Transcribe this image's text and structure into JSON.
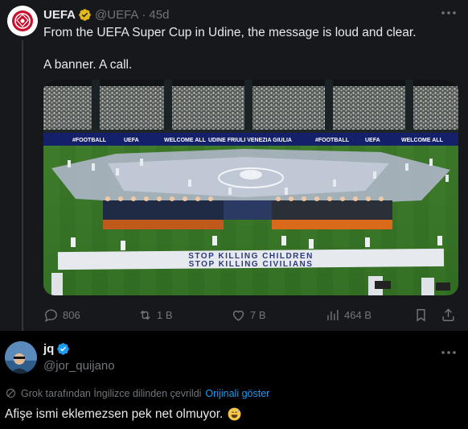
{
  "post": {
    "author_name": "UEFA",
    "author_handle": "@UEFA",
    "separator": "·",
    "time": "45d",
    "text": "From the UEFA Super Cup in Udine, the message is loud and clear.\n\nA banner. A call.",
    "media": {
      "board_texts": [
        "#FOOTBALL",
        "UEFA",
        "WELCOME ALL",
        "UDINE FRIULI VENEZIA GIULIA",
        "#FOOTBALL",
        "UEFA",
        "WELCOME ALL"
      ],
      "banner_line1": "STOP KILLING CHILDREN",
      "banner_line2": "STOP KILLING CIVILIANS"
    },
    "stats": {
      "replies": "806",
      "reposts": "1 B",
      "likes": "7 B",
      "views": "464 B"
    }
  },
  "reply": {
    "author_name": "jq",
    "author_handle": "@jor_quijano",
    "translation_note": "Grok tarafından İngilizce dilinden çevrildi",
    "show_original": "Orijinali göster",
    "text": "Afişe ismi eklemezsen pek net olmuyor."
  },
  "colors": {
    "accent": "#1d9bf0",
    "verified_gold": "#e2b719",
    "muted": "#71767b"
  }
}
